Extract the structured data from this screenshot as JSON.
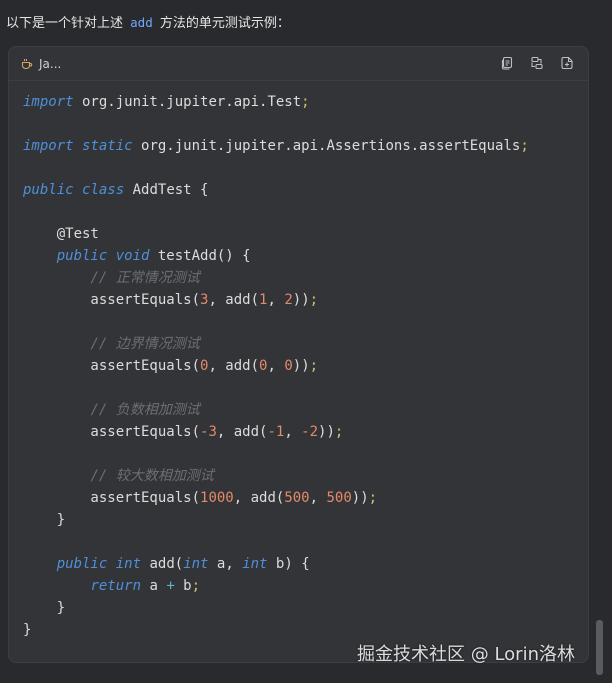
{
  "intro": {
    "before": "以下是一个针对上述",
    "code_ref": "add",
    "after": "方法的单元测试示例："
  },
  "code_block": {
    "language_label": "Ja...",
    "icons": [
      "coffee-icon",
      "copy-icon",
      "wrap-icon",
      "insert-icon"
    ],
    "lines": [
      [
        {
          "t": "import",
          "c": "kw"
        },
        {
          "t": " org.junit.jupiter.api.Test"
        },
        {
          "t": ";",
          "c": "pun"
        }
      ],
      [],
      [
        {
          "t": "import",
          "c": "kw"
        },
        {
          "t": " "
        },
        {
          "t": "static",
          "c": "kw"
        },
        {
          "t": " org.junit.jupiter.api.Assertions.assertEquals"
        },
        {
          "t": ";",
          "c": "pun"
        }
      ],
      [],
      [
        {
          "t": "public",
          "c": "kw"
        },
        {
          "t": " "
        },
        {
          "t": "class",
          "c": "kw"
        },
        {
          "t": " AddTest {"
        }
      ],
      [],
      [
        {
          "t": "    @Test"
        }
      ],
      [
        {
          "t": "    "
        },
        {
          "t": "public",
          "c": "kw"
        },
        {
          "t": " "
        },
        {
          "t": "void",
          "c": "kw"
        },
        {
          "t": " testAdd() {"
        }
      ],
      [
        {
          "t": "        "
        },
        {
          "t": "// 正常情况测试",
          "c": "cmt"
        }
      ],
      [
        {
          "t": "        assertEquals("
        },
        {
          "t": "3",
          "c": "num"
        },
        {
          "t": ", add("
        },
        {
          "t": "1",
          "c": "num"
        },
        {
          "t": ", "
        },
        {
          "t": "2",
          "c": "num"
        },
        {
          "t": "))"
        },
        {
          "t": ";",
          "c": "pun"
        }
      ],
      [],
      [
        {
          "t": "        "
        },
        {
          "t": "// 边界情况测试",
          "c": "cmt"
        }
      ],
      [
        {
          "t": "        assertEquals("
        },
        {
          "t": "0",
          "c": "num"
        },
        {
          "t": ", add("
        },
        {
          "t": "0",
          "c": "num"
        },
        {
          "t": ", "
        },
        {
          "t": "0",
          "c": "num"
        },
        {
          "t": "))"
        },
        {
          "t": ";",
          "c": "pun"
        }
      ],
      [],
      [
        {
          "t": "        "
        },
        {
          "t": "// 负数相加测试",
          "c": "cmt"
        }
      ],
      [
        {
          "t": "        assertEquals("
        },
        {
          "t": "-3",
          "c": "num"
        },
        {
          "t": ", add("
        },
        {
          "t": "-1",
          "c": "num"
        },
        {
          "t": ", "
        },
        {
          "t": "-2",
          "c": "num"
        },
        {
          "t": "))"
        },
        {
          "t": ";",
          "c": "pun"
        }
      ],
      [],
      [
        {
          "t": "        "
        },
        {
          "t": "// 较大数相加测试",
          "c": "cmt"
        }
      ],
      [
        {
          "t": "        assertEquals("
        },
        {
          "t": "1000",
          "c": "num"
        },
        {
          "t": ", add("
        },
        {
          "t": "500",
          "c": "num"
        },
        {
          "t": ", "
        },
        {
          "t": "500",
          "c": "num"
        },
        {
          "t": "))"
        },
        {
          "t": ";",
          "c": "pun"
        }
      ],
      [
        {
          "t": "    }"
        }
      ],
      [],
      [
        {
          "t": "    "
        },
        {
          "t": "public",
          "c": "kw"
        },
        {
          "t": " "
        },
        {
          "t": "int",
          "c": "kw"
        },
        {
          "t": " add("
        },
        {
          "t": "int",
          "c": "kw"
        },
        {
          "t": " a, "
        },
        {
          "t": "int",
          "c": "kw"
        },
        {
          "t": " b) {"
        }
      ],
      [
        {
          "t": "        "
        },
        {
          "t": "return",
          "c": "kw"
        },
        {
          "t": " a "
        },
        {
          "t": "+",
          "c": "op"
        },
        {
          "t": " b"
        },
        {
          "t": ";",
          "c": "pun"
        }
      ],
      [
        {
          "t": "    }"
        }
      ],
      [
        {
          "t": "}"
        }
      ]
    ]
  },
  "watermark": "掘金技术社区 @ Lorin洛林",
  "colors": {
    "background": "#292a2d",
    "card": "#333438",
    "keyword": "#4f8fd8",
    "number": "#e28a6a",
    "comment": "#6b6e74",
    "link": "#6ea8fe"
  }
}
